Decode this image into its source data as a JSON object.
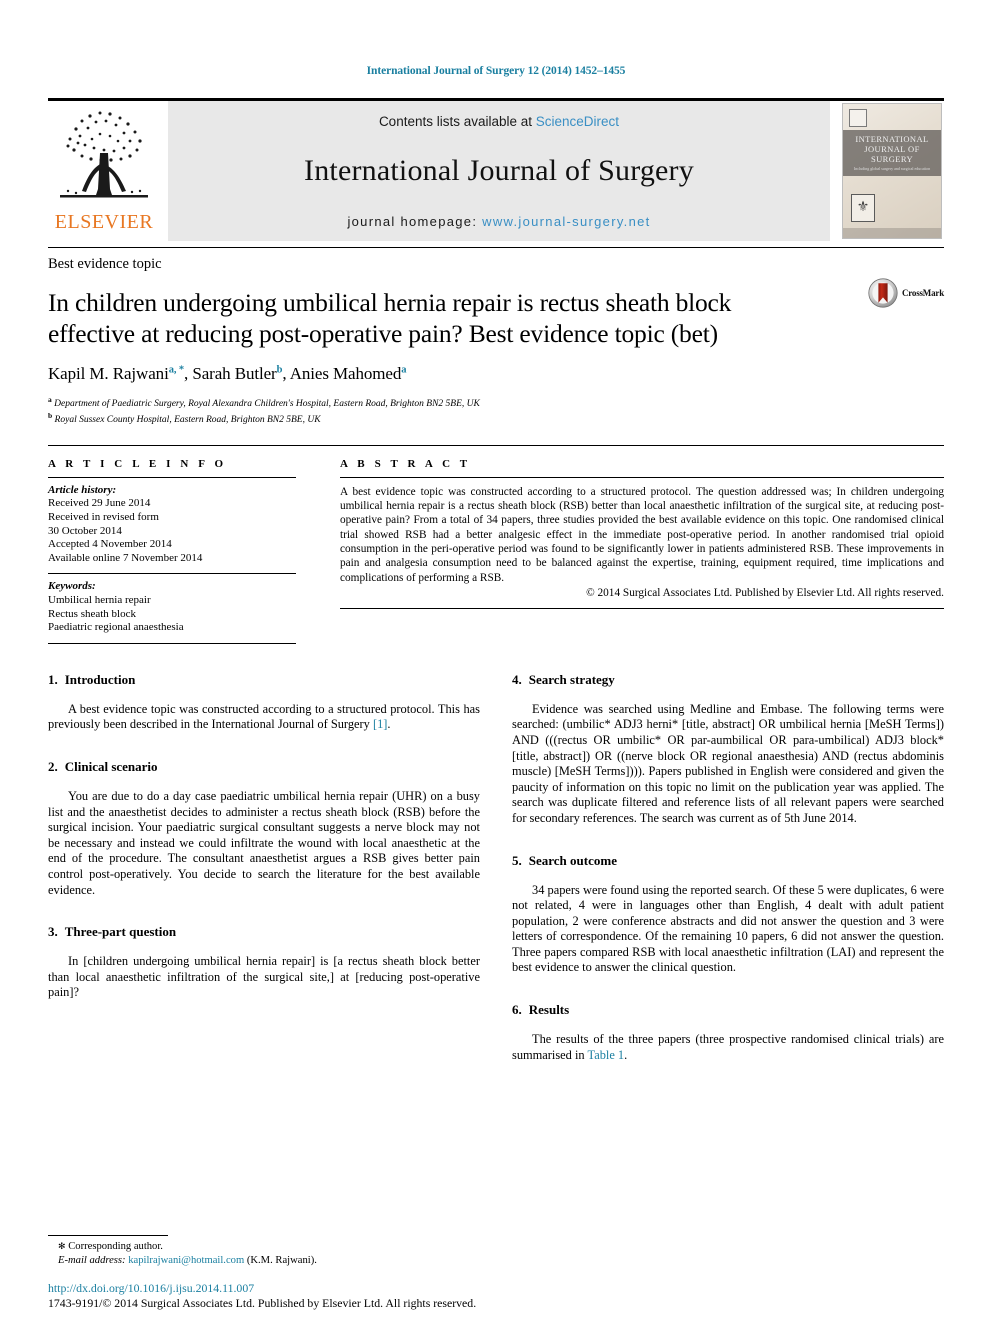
{
  "running_head": "International Journal of Surgery 12 (2014) 1452–1455",
  "masthead": {
    "contents_prefix": "Contents lists available at ",
    "sciencedirect": "ScienceDirect",
    "journal_name": "International Journal of Surgery",
    "homepage_prefix": "journal homepage: ",
    "homepage_url": "www.journal-surgery.net",
    "publisher": "ELSEVIER",
    "cover_title_line1": "INTERNATIONAL",
    "cover_title_line2": "JOURNAL OF SURGERY",
    "cover_subtitle": "Including global surgery and surgical education",
    "accent_link_color": "#3a8fc4",
    "banner_bg": "#e8e8e8",
    "elsevier_orange": "#e87722"
  },
  "article": {
    "category": "Best evidence topic",
    "title": "In children undergoing umbilical hernia repair is rectus sheath block effective at reducing post-operative pain? Best evidence topic (bet)",
    "authors_html": "Kapil M. Rajwani, Sarah Butler, Anies Mahomed",
    "author_list": [
      {
        "name": "Kapil M. Rajwani",
        "marks": "a, *"
      },
      {
        "name": "Sarah Butler",
        "marks": "b"
      },
      {
        "name": "Anies Mahomed",
        "marks": "a"
      }
    ],
    "affiliations": [
      {
        "mark": "a",
        "text": "Department of Paediatric Surgery, Royal Alexandra Children's Hospital, Eastern Road, Brighton BN2 5BE, UK"
      },
      {
        "mark": "b",
        "text": "Royal Sussex County Hospital, Eastern Road, Brighton BN2 5BE, UK"
      }
    ],
    "crossmark_label": "CrossMark"
  },
  "info": {
    "heading": "A R T I C L E  I N F O",
    "history_label": "Article history:",
    "history": [
      "Received 29 June 2014",
      "Received in revised form",
      "30 October 2014",
      "Accepted 4 November 2014",
      "Available online 7 November 2014"
    ],
    "keywords_label": "Keywords:",
    "keywords": [
      "Umbilical hernia repair",
      "Rectus sheath block",
      "Paediatric regional anaesthesia"
    ]
  },
  "abstract": {
    "heading": "A B S T R A C T",
    "text": "A best evidence topic was constructed according to a structured protocol. The question addressed was; In children undergoing umbilical hernia repair is a rectus sheath block (RSB) better than local anaesthetic infiltration of the surgical site, at reducing post-operative pain? From a total of 34 papers, three studies provided the best available evidence on this topic. One randomised clinical trial showed RSB had a better analgesic effect in the immediate post-operative period. In another randomised trial opioid consumption in the peri-operative period was found to be significantly lower in patients administered RSB. These improvements in pain and analgesia consumption need to be balanced against the expertise, training, equipment required, time implications and complications of performing a RSB.",
    "copyright": "© 2014 Surgical Associates Ltd. Published by Elsevier Ltd. All rights reserved."
  },
  "sections": {
    "left": [
      {
        "number": "1.",
        "title": "Introduction",
        "paragraphs": [
          {
            "before": "A best evidence topic was constructed according to a structured protocol. This has previously been described in the International Journal of Surgery ",
            "link": "[1]",
            "after": "."
          }
        ]
      },
      {
        "number": "2.",
        "title": "Clinical scenario",
        "paragraphs": [
          {
            "before": "You are due to do a day case paediatric umbilical hernia repair (UHR) on a busy list and the anaesthetist decides to administer a rectus sheath block (RSB) before the surgical incision. Your paediatric surgical consultant suggests a nerve block may not be necessary and instead we could infiltrate the wound with local anaesthetic at the end of the procedure. The consultant anaesthetist argues a RSB gives better pain control post-operatively. You decide to search the literature for the best available evidence.",
            "link": "",
            "after": ""
          }
        ]
      },
      {
        "number": "3.",
        "title": "Three-part question",
        "paragraphs": [
          {
            "before": "In [children undergoing umbilical hernia repair] is [a rectus sheath block better than local anaesthetic infiltration of the surgical site,] at [reducing post-operative pain]?",
            "link": "",
            "after": ""
          }
        ]
      }
    ],
    "right": [
      {
        "number": "4.",
        "title": "Search strategy",
        "paragraphs": [
          {
            "before": "Evidence was searched using Medline and Embase. The following terms were searched: (umbilic* ADJ3 herni* [title, abstract] OR umbilical hernia [MeSH Terms]) AND (((rectus OR umbilic* OR par-aumbilical OR para-umbilical) ADJ3 block* [title, abstract]) OR ((nerve block OR regional anaesthesia) AND (rectus abdominis muscle) [MeSH Terms]))). Papers published in English were considered and given the paucity of information on this topic no limit on the publication year was applied. The search was duplicate filtered and reference lists of all relevant papers were searched for secondary references. The search was current as of 5th June 2014.",
            "link": "",
            "after": ""
          }
        ]
      },
      {
        "number": "5.",
        "title": "Search outcome",
        "paragraphs": [
          {
            "before": "34 papers were found using the reported search. Of these 5 were duplicates, 6 were not related, 4 were in languages other than English, 4 dealt with adult patient population, 2 were conference abstracts and did not answer the question and 3 were letters of correspondence. Of the remaining 10 papers, 6 did not answer the question. Three papers compared RSB with local anaesthetic infiltration (LAI) and represent the best evidence to answer the clinical question.",
            "link": "",
            "after": ""
          }
        ]
      },
      {
        "number": "6.",
        "title": "Results",
        "paragraphs": [
          {
            "before": "The results of the three papers (three prospective randomised clinical trials) are summarised in ",
            "link": "Table 1",
            "after": "."
          }
        ]
      }
    ]
  },
  "footnote": {
    "corresponding": "Corresponding author.",
    "email_label": "E-mail address:",
    "email": "kapilrajwani@hotmail.com",
    "email_attrib": "(K.M. Rajwani)."
  },
  "footer": {
    "doi": "http://dx.doi.org/10.1016/j.ijsu.2014.11.007",
    "issn_line": "1743-9191/© 2014 Surgical Associates Ltd. Published by Elsevier Ltd. All rights reserved."
  }
}
